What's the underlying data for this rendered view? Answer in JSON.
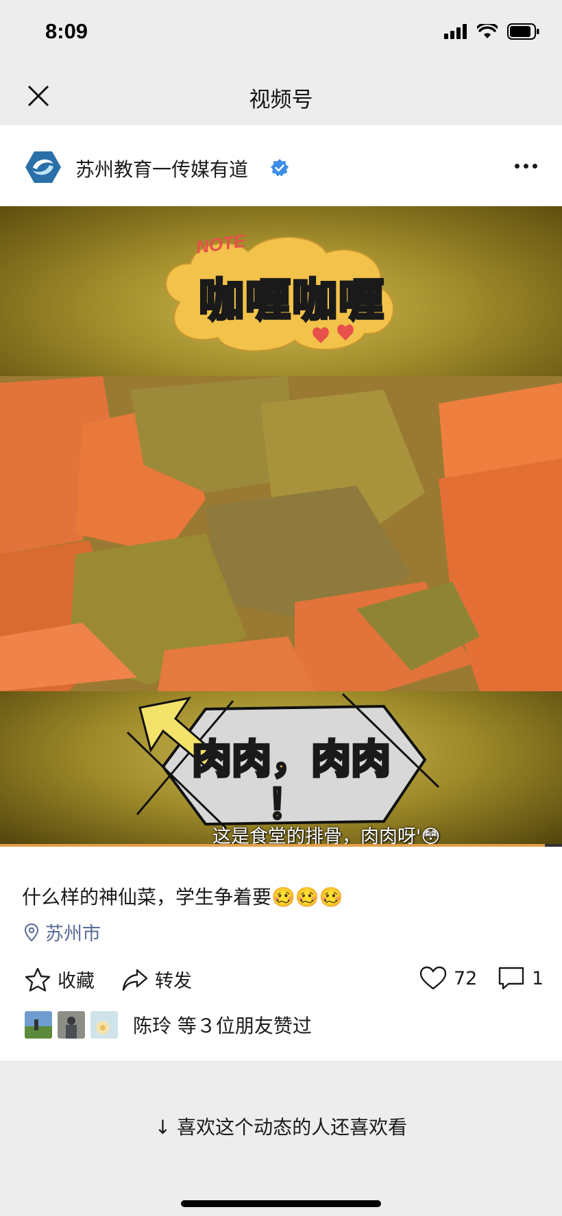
{
  "status_bar": {
    "time": "8:09"
  },
  "nav": {
    "title": "视频号",
    "close_icon": "close-icon"
  },
  "author": {
    "name": "苏州教育一传媒有道",
    "verified": true
  },
  "video": {
    "note_tag": "NOTE",
    "sticker_title": "咖喱咖喱",
    "sticker_meat": "肉肉，肉肉",
    "sticker_exclaim": "！",
    "subtitle": "这是食堂的排骨，肉肉呀'😳",
    "progress": 0.97
  },
  "post": {
    "caption": "什么样的神仙菜，学生争着要🥴🥴🥴",
    "location": "苏州市"
  },
  "actions": {
    "favorite_label": "收藏",
    "share_label": "转发",
    "like_count": "72",
    "comment_count": "1"
  },
  "liked_by": {
    "text": "陈玲 等３位朋友赞过"
  },
  "recommend": {
    "label": "喜欢这个动态的人还喜欢看"
  },
  "colors": {
    "link": "#576b95",
    "verified": "#3d8ee8",
    "progress": "#e2a04a"
  }
}
